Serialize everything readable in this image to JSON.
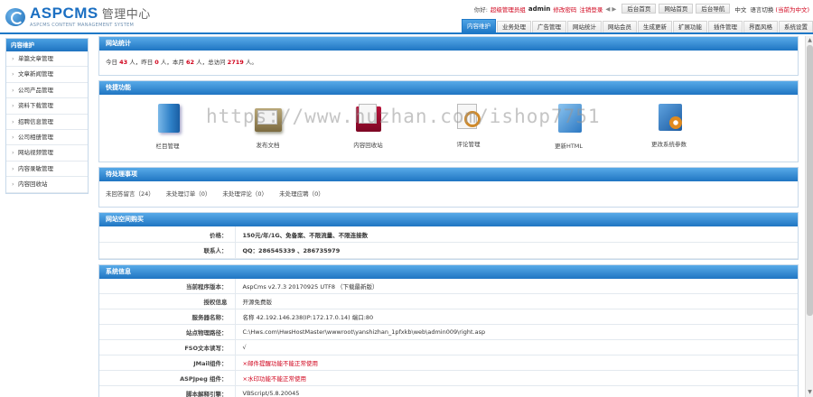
{
  "brand": {
    "title": "ASPCMS",
    "subtitle_cn": "管理中心",
    "tagline": "ASPCMS CONTENT MANAGEMENT SYSTEM"
  },
  "userbar": {
    "greeting": "你好:",
    "role": "超级管理员组",
    "username": "admin",
    "change_password": "修改密码",
    "logout": "注销登录",
    "arrows": "◀ ▶",
    "btn_admin_home": "后台首页",
    "btn_site_home": "网站首页",
    "btn_admin_nav": "后台导航",
    "lang_label": "中文",
    "lang_switch": "语言切换",
    "lang_current": "(当前为中文)"
  },
  "nav": {
    "tabs": [
      "内容维护",
      "业务处理",
      "广告管理",
      "网站统计",
      "网站会员",
      "生成更新",
      "扩展功能",
      "插件管理",
      "界面风格",
      "系统设置"
    ]
  },
  "sidebar": {
    "title": "内容维护",
    "items": [
      "单篇文章管理",
      "文章新闻管理",
      "公司产品管理",
      "资料下载管理",
      "招聘信息管理",
      "公司相册管理",
      "网站视频管理",
      "内容录敏管理",
      "内容回收站"
    ]
  },
  "stats": {
    "title": "网站统计",
    "prefix_today": "今日",
    "today": "43",
    "mid_yesterday": "人，昨日",
    "yesterday": "0",
    "mid_month": "人，本月",
    "month": "62",
    "mid_total": "人，总访问",
    "total": "2719",
    "suffix": "人。"
  },
  "quick": {
    "title": "快捷功能",
    "items": [
      {
        "label": "栏目管理",
        "icon": "folder-book-icon"
      },
      {
        "label": "发布文档",
        "icon": "publish-doc-icon"
      },
      {
        "label": "内容回收站",
        "icon": "recycle-bin-icon"
      },
      {
        "label": "评论管理",
        "icon": "comment-magnifier-icon"
      },
      {
        "label": "更新HTML",
        "icon": "update-html-icon"
      },
      {
        "label": "更改系统参数",
        "icon": "system-settings-icon"
      }
    ]
  },
  "pending": {
    "title": "待处理事项",
    "items": [
      "未回答留言（24）",
      "未处理订单（0）",
      "未处理评论（0）",
      "未处理应聘（0）"
    ]
  },
  "purchase": {
    "title": "网站空间购买",
    "rows": [
      {
        "key": "价格：",
        "value": "150元/年/1G、免备案、不限流量、不限连接数"
      },
      {
        "key": "联系人：",
        "value": "QQ：286545339 、286735979"
      }
    ]
  },
  "sysinfo": {
    "title": "系统信息",
    "rows": [
      {
        "key": "当前程序版本：",
        "value": "AspCms v2.7.3 20170925 UTF8 （下载最新版）"
      },
      {
        "key": "授权信息",
        "value": "开源免费版"
      },
      {
        "key": "服务器名称：",
        "value": "名称 42.192.146.238(IP:172.17.0.14) 端口:80"
      },
      {
        "key": "站点物理路径：",
        "value": "C:\\Hws.com\\HwsHostMaster\\wwwroot\\yanshizhan_1pfxkb\\web\\admin009\\right.asp"
      },
      {
        "key": "FSO文本读写：",
        "value": "√"
      },
      {
        "key": "JMail组件：",
        "value": "×邮件提醒功能不能正常使用"
      },
      {
        "key": "ASPJpeg 组件：",
        "value": "×水印功能不能正常使用"
      },
      {
        "key": "脚本解释引擎：",
        "value": "VBScript/5.8.20045"
      }
    ]
  },
  "watermark": "https://www.huzhan.com/ishop7751",
  "colors": {
    "accent": "#1e78c7",
    "alert": "#d0021b",
    "panel_border": "#c7d9ea"
  }
}
